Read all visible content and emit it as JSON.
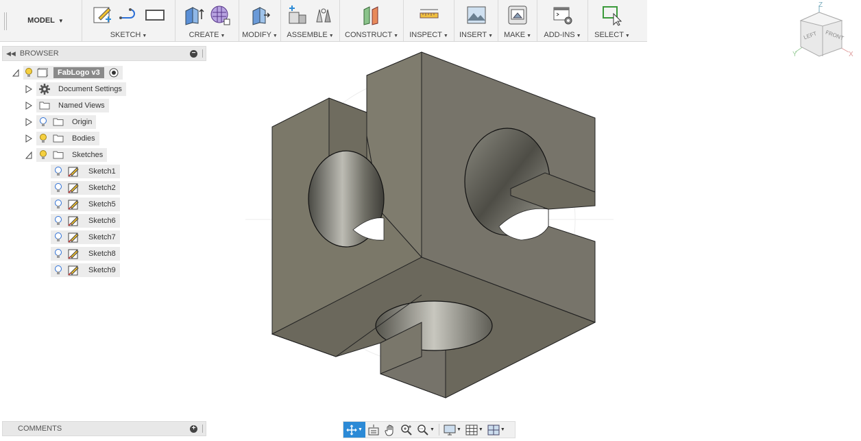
{
  "toolbar": {
    "workspace": "MODEL",
    "groups": [
      {
        "label": "SKETCH"
      },
      {
        "label": "CREATE"
      },
      {
        "label": "MODIFY"
      },
      {
        "label": "ASSEMBLE"
      },
      {
        "label": "CONSTRUCT"
      },
      {
        "label": "INSPECT"
      },
      {
        "label": "INSERT"
      },
      {
        "label": "MAKE"
      },
      {
        "label": "ADD-INS"
      },
      {
        "label": "SELECT"
      }
    ]
  },
  "browser": {
    "title": "BROWSER",
    "root": {
      "label": "FabLogo v3"
    },
    "items": [
      {
        "label": "Document Settings",
        "icon": "gear-icon"
      },
      {
        "label": "Named Views",
        "icon": "folder-icon"
      },
      {
        "label": "Origin",
        "icon": "folder-icon"
      },
      {
        "label": "Bodies",
        "icon": "folder-icon"
      },
      {
        "label": "Sketches",
        "icon": "folder-icon"
      }
    ],
    "sketches": [
      "Sketch1",
      "Sketch2",
      "Sketch5",
      "Sketch6",
      "Sketch7",
      "Sketch8",
      "Sketch9"
    ]
  },
  "comments": {
    "title": "COMMENTS"
  },
  "viewcube": {
    "top": "Z",
    "left": "LEFT",
    "front": "FRONT",
    "x": "X",
    "y": "Y"
  },
  "colors": {
    "accent": "#2c8ad6",
    "model_face": "#7a7768",
    "bulb": "#f5d040"
  }
}
